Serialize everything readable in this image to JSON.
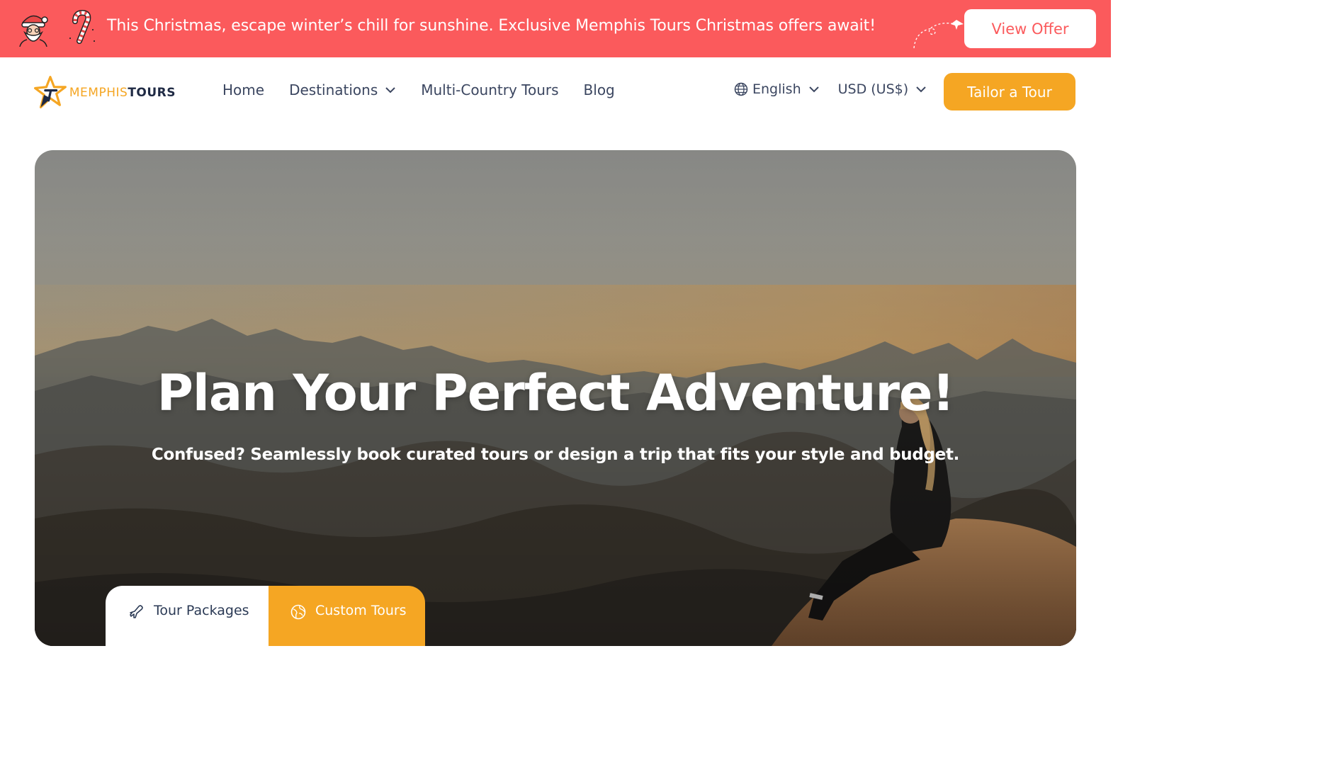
{
  "promo": {
    "message": "This Christmas, escape winter’s chill for sunshine. Exclusive Memphis Tours Christmas offers await!",
    "cta": "View Offer",
    "icons": [
      "santa-icon",
      "candy-cane-icon",
      "paper-plane-icon"
    ],
    "background": "#fb5a5c"
  },
  "header": {
    "logo": {
      "part1": "MEMPHIS",
      "part2": "TOURS"
    },
    "nav": [
      {
        "label": "Home"
      },
      {
        "label": "Destinations",
        "has_dropdown": true
      },
      {
        "label": "Multi-Country Tours"
      },
      {
        "label": "Blog"
      }
    ],
    "language": "English",
    "currency": "USD (US$)",
    "tailor_button": "Tailor a Tour"
  },
  "hero": {
    "title": "Plan Your Perfect Adventure!",
    "subtitle": "Confused? Seamlessly book curated tours or design a trip that fits your style and budget.",
    "tabs": [
      {
        "label": "Tour Packages",
        "icon": "airplane-icon",
        "active": false
      },
      {
        "label": "Custom Tours",
        "icon": "globe-route-icon",
        "active": true
      }
    ]
  },
  "colors": {
    "accent": "#f5a623",
    "banner": "#fb5a5c",
    "text": "#3b4660"
  }
}
